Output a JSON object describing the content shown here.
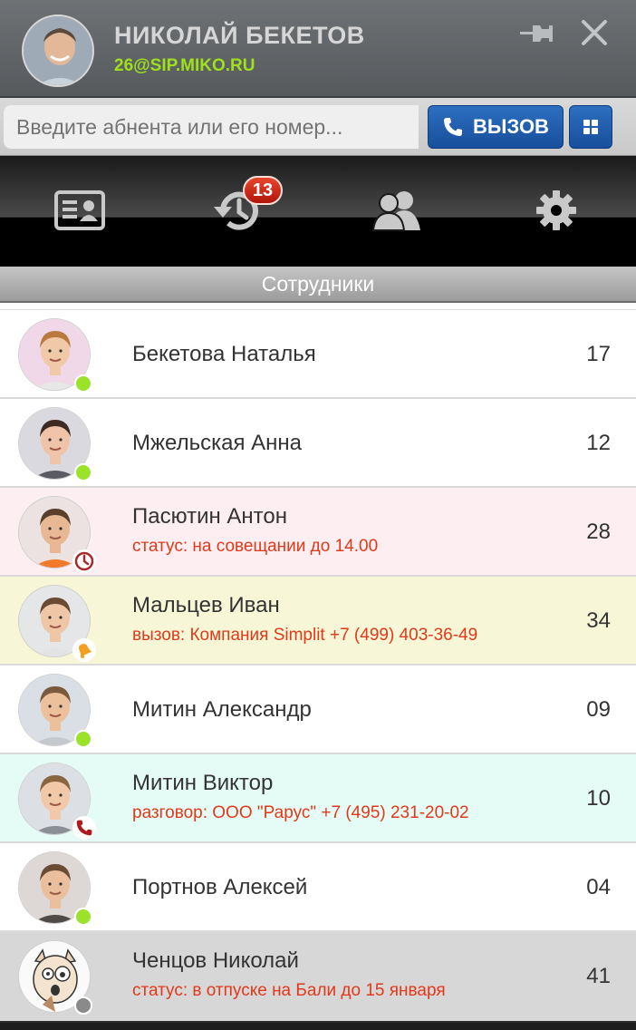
{
  "user": {
    "name": "НИКОЛАЙ БЕКЕТОВ",
    "sip": "26@SIP.MIKO.RU"
  },
  "search": {
    "placeholder": "Введите абнента или его номер...",
    "value": ""
  },
  "call_button": {
    "label": "ВЫЗОВ"
  },
  "tabs": [
    {
      "name": "contact-card",
      "icon": "contact-card-icon"
    },
    {
      "name": "history",
      "icon": "history-icon",
      "badge": "13"
    },
    {
      "name": "employees",
      "icon": "people-icon"
    },
    {
      "name": "settings",
      "icon": "gear-icon"
    }
  ],
  "section": {
    "title": "Сотрудники"
  },
  "contacts": [
    {
      "name": "Бекетова Наталья",
      "ext": "17",
      "status_text": "",
      "state": "online",
      "bg": "#ffffff"
    },
    {
      "name": "Мжельская Анна",
      "ext": "12",
      "status_text": "",
      "state": "online",
      "bg": "#ffffff"
    },
    {
      "name": "Пасютин Антон",
      "ext": "28",
      "status_text": "статус: на совещании до 14.00",
      "state": "meeting",
      "bg": "#fdeef1"
    },
    {
      "name": "Мальцев Иван",
      "ext": "34",
      "status_text": "вызов: Компания Simplit +7 (499) 403-36-49",
      "state": "ringing",
      "bg": "#f7f7d7"
    },
    {
      "name": "Митин Александр",
      "ext": "09",
      "status_text": "",
      "state": "online",
      "bg": "#ffffff"
    },
    {
      "name": "Митин Виктор",
      "ext": "10",
      "status_text": "разговор: ООО \"Рарус\" +7 (495) 231-20-02",
      "state": "talking",
      "bg": "#e5fbf6"
    },
    {
      "name": "Портнов Алексей",
      "ext": "04",
      "status_text": "",
      "state": "online",
      "bg": "#ffffff"
    },
    {
      "name": "Ченцов Николай",
      "ext": "41",
      "status_text": "статус: в отпуске на Бали до 15 января",
      "state": "offline",
      "bg": "#d7d7d7"
    }
  ],
  "colors": {
    "online": "#9be22b",
    "offline": "#8a8a8a",
    "status_text": "#e2391a",
    "accent_blue": "#1f5fae",
    "sip_green": "#9ee11b"
  }
}
